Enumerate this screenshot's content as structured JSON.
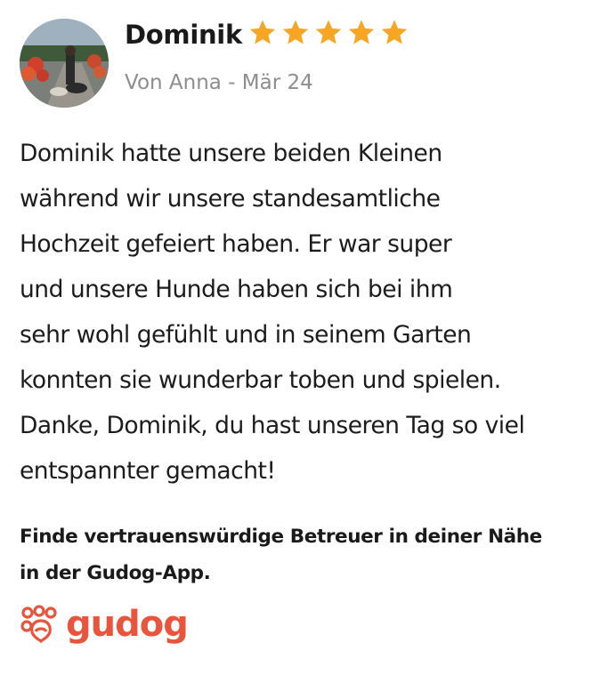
{
  "review": {
    "name": "Dominik",
    "rating": 5,
    "rating_max": 5,
    "meta": "Von Anna - Mär 24",
    "text_lines": [
      "Dominik hatte unsere beiden Kleinen",
      "während wir unsere standesamtliche",
      "Hochzeit gefeiert haben. Er war super",
      "und unsere Hunde haben sich bei ihm",
      "sehr wohl gefühlt und in seinem Garten",
      "konnten sie wunderbar toben und spielen.",
      "Danke, Dominik, du hast unseren Tag so viel",
      "entspannter gemacht!"
    ]
  },
  "cta": {
    "lines": [
      "Finde vertrauenswürdige Betreuer in deiner Nähe",
      "in der Gudog-App."
    ]
  },
  "brand": {
    "name": "gudog",
    "logo_icon": "paw-logo-icon",
    "color": "#e9553c"
  },
  "colors": {
    "star": "#f6a623",
    "meta_text": "#8d8d8d",
    "body_text": "#1c1c1c"
  }
}
